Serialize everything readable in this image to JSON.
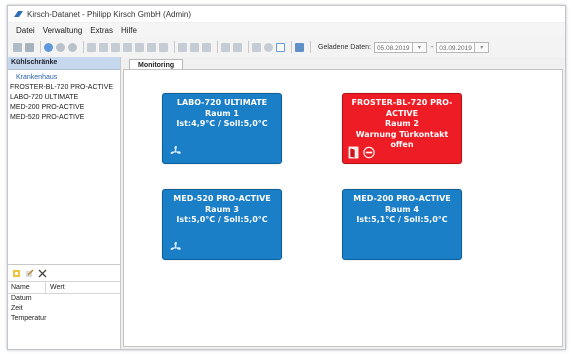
{
  "window": {
    "title": "Kirsch-Datanet - Philipp Kirsch GmbH (Admin)"
  },
  "menu": [
    "Datei",
    "Verwaltung",
    "Extras",
    "Hilfe"
  ],
  "toolbar": {
    "loaded_label": "Geladene Daten:",
    "date_from": "05.08.2019",
    "date_separator": "-",
    "date_to": "03.09.2019"
  },
  "sidebar": {
    "header": "Kühlschränke",
    "root": "Krankenhaus",
    "items": [
      "FROSTER-BL-720 PRO-ACTIVE",
      "LABO-720 ULTIMATE",
      "MED-200 PRO-ACTIVE",
      "MED-520 PRO-ACTIVE"
    ]
  },
  "properties": {
    "col_name": "Name",
    "col_value": "Wert",
    "rows": [
      "Datum",
      "Zeit",
      "Temperatur"
    ]
  },
  "tabs": {
    "monitoring": "Monitoring"
  },
  "tiles": [
    {
      "name": "LABO-720 ULTIMATE",
      "room": "Raum 1",
      "status": "Ist:4,9°C / Soll:5,0°C",
      "color": "#1b7fc7"
    },
    {
      "name": "FROSTER-BL-720 PRO-ACTIVE",
      "room": "Raum 2",
      "status": "Warnung Türkontakt offen",
      "color": "#ee1c24"
    },
    {
      "name": "MED-520 PRO-ACTIVE",
      "room": "Raum 3",
      "status": "Ist:5,0°C / Soll:5,0°C",
      "color": "#1b7fc7"
    },
    {
      "name": "MED-200 PRO-ACTIVE",
      "room": "Raum 4",
      "status": "Ist:5,1°C / Soll:5,0°C",
      "color": "#1b7fc7"
    }
  ]
}
